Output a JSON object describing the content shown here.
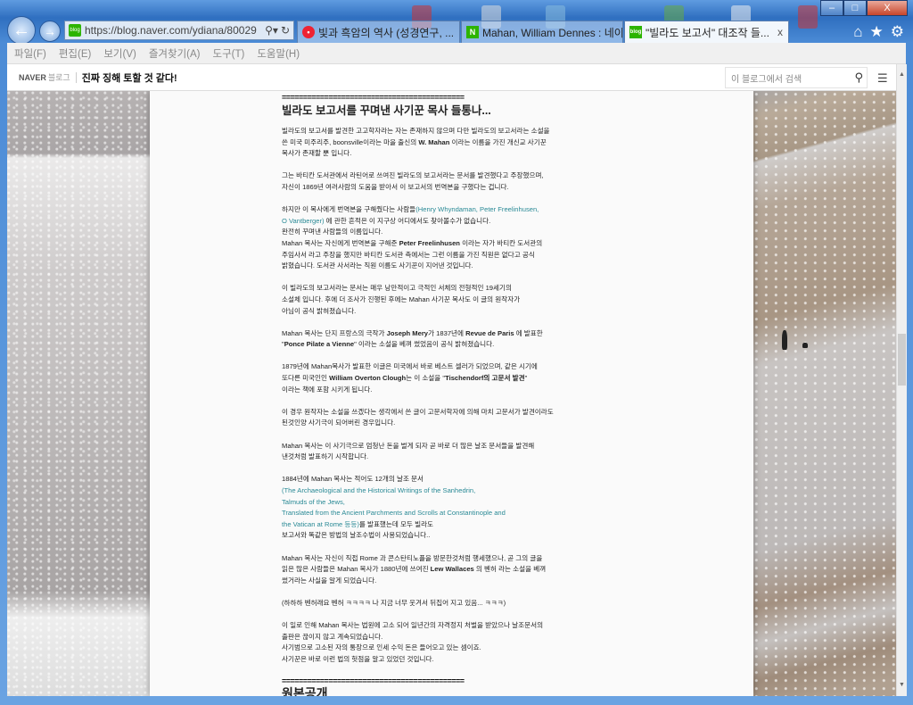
{
  "browser": {
    "address": "https://blog.naver.com/ydiana/80029",
    "tabs": [
      {
        "label": "빛과 흑암의 역사 (성경연구, ...",
        "icon": "red-circle-icon"
      },
      {
        "label": "Mahan, William Dennes : 네이...",
        "icon": "naver-n-icon"
      },
      {
        "label": "\"빌라도 보고서\" 대조작 들...",
        "icon": "blog-icon"
      }
    ],
    "tab_close": "x",
    "menu": [
      "파일(F)",
      "편집(E)",
      "보기(V)",
      "즐겨찾기(A)",
      "도구(T)",
      "도움말(H)"
    ],
    "window_buttons": {
      "min": "–",
      "max": "□",
      "close": "X"
    }
  },
  "blog": {
    "brand": "NAVER",
    "brand_sub": "블로그",
    "title": "진짜 징해 토할 것 같다!",
    "search_placeholder": "이 블로그에서 검색"
  },
  "article": {
    "divider": "===========================================",
    "title": "빌라도 보고서를 꾸며낸 사기꾼 목사 들통나...",
    "paragraphs": [
      [
        [
          [
            "빌라도의 보고서를 발견한 고고학자라는 자는 존재하지 않으며 다만 빌라도의 보고서라는 소설을",
            ""
          ]
        ],
        [
          [
            "쓴 미국 미주리주, boonsville이라는 마을 출신의 ",
            ""
          ],
          [
            "W. Mahan",
            "b"
          ],
          [
            " 이라는 이름을 가진 개신교 사기꾼",
            ""
          ]
        ],
        [
          [
            "목사가 존재할 뿐 입니다.",
            ""
          ]
        ]
      ],
      [
        [
          [
            "그는 바티칸 도서관에서 라틴어로 쓰여진 빌라도의 보고서라는 문서를 발견했다고 주장했으며,",
            ""
          ]
        ],
        [
          [
            "자신이 1869년 여러사람의 도움을 받아서 이 보고서의 번역본을 구했다는 겁니다.",
            ""
          ]
        ]
      ],
      [
        [
          [
            "하지만 이 목사에게 번역본을 구해줬다는 사람들",
            ""
          ],
          [
            "(Henry Whyndaman, Peter Freelinhusen,",
            "lnk"
          ]
        ],
        [
          [
            "O Vantberger)",
            "lnk"
          ],
          [
            " 에 관한 흔적은 이 지구상 어디에서도 찾아볼수가 없습니다.",
            ""
          ]
        ],
        [
          [
            "완전히 꾸며낸 사람들의 이름입니다.",
            ""
          ]
        ],
        [
          [
            "Mahan 목사는 자신에게 번역본을 구해준 ",
            ""
          ],
          [
            "Peter Freelinhusen",
            "b"
          ],
          [
            " 이라는 자가 바티칸 도서관의",
            ""
          ]
        ],
        [
          [
            "주임사서 라고 주장을 했지만 바티칸 도서관 측에서는 그런 이름을 가진 직원은 없다고 공식",
            ""
          ]
        ],
        [
          [
            "밝혔습니다. 도서관 사서라는 직원 이름도 사기꾼이 지어낸 것입니다.",
            ""
          ]
        ]
      ],
      [
        [
          [
            "이 빌라도의 보고서라는 문서는 매우 낭만적이고 극적인 서체의 전형적인 19세기의",
            ""
          ]
        ],
        [
          [
            "소설체 입니다. 후에 더 조사가 진행된 후에는 Mahan 사기꾼 목사도 이 글의 원작자가",
            ""
          ]
        ],
        [
          [
            "아님이 공식 밝혀졌습니다.",
            ""
          ]
        ]
      ],
      [
        [
          [
            "Mahan 목사는 단지 프랑스의 극작가 ",
            ""
          ],
          [
            "Joseph Mery",
            "b"
          ],
          [
            "가 1837년에 ",
            ""
          ],
          [
            "Revue de Paris",
            "b"
          ],
          [
            " 에 발표한",
            ""
          ]
        ],
        [
          [
            "\"",
            ""
          ],
          [
            "Ponce Pilate a Vienne",
            "b"
          ],
          [
            "\" 이라는 소설을 베껴 썼었음이 공식 밝혀졌습니다.",
            ""
          ]
        ]
      ],
      [
        [
          [
            "1879년에 Mahan목사가 발표한 이글은 미국에서 바로 베스트 셀러가 되었으며, 같은 시기에",
            ""
          ]
        ],
        [
          [
            "또다른 미국인인 ",
            ""
          ],
          [
            "William Overton Clough",
            "b"
          ],
          [
            "는 이 소설을 \"",
            ""
          ],
          [
            "Tischendorf의 고문서 발견",
            "b"
          ],
          [
            "\"",
            ""
          ]
        ],
        [
          [
            "이라는 책에 포함 시키게 됩니다.",
            ""
          ]
        ]
      ],
      [
        [
          [
            "이 경우 원작자는 소설을 쓰겠다는 생각에서 쓴 글이 고문서학자에 의해 마치 고문서가 발견이라도",
            ""
          ]
        ],
        [
          [
            "된것인양 사기극이 되어버린 경우입니다.",
            ""
          ]
        ]
      ],
      [
        [
          [
            "Mahan 목사는 이 사기극으로 엄청난 돈을 벌게 되자 곧 바로 더 많은 날조 문서들을 발견해",
            ""
          ]
        ],
        [
          [
            "낸것처럼 발표하기 시작합니다.",
            ""
          ]
        ]
      ],
      [
        [
          [
            "1884년에 Mahan 목사는 적어도 12개의 날조 문서",
            ""
          ]
        ],
        [
          [
            "(The Archaeological and the Historical Writings of the Sanhedrin,",
            "lnk"
          ]
        ],
        [
          [
            "Talmuds of the Jews,",
            "lnk"
          ]
        ],
        [
          [
            "Translated from the Ancient Parchments and Scrolls at Constantinople and",
            "lnk"
          ]
        ],
        [
          [
            "the Vatican at Rome 등등)",
            "lnk"
          ],
          [
            "를 발표했는데 모두 빌라도",
            ""
          ]
        ],
        [
          [
            "보고서와 똑같은 방법의 날조수법이 사용되었습니다..",
            ""
          ]
        ]
      ],
      [
        [
          [
            "Mahan 목사는 자신이 직접 Rome 과 콘스탄티노플을 방문한것처럼 행세했으나, 곧 그의 글을",
            ""
          ]
        ],
        [
          [
            "읽은 많은 사람들은 Mahan 목사가 1880년에 쓰여진 ",
            ""
          ],
          [
            "Lew Wallaces",
            "b"
          ],
          [
            " 의 벤허 라는 소설을 베껴",
            ""
          ]
        ],
        [
          [
            "썼거라는 사실을 알게 되었습니다.",
            ""
          ]
        ]
      ],
      [
        [
          [
            "(하하하 벤허래요 벤허 ㅋㅋㅋㅋ 나 지금 너무 웃겨서 뒤집어 지고 있음... ㅋㅋㅋ)",
            ""
          ]
        ]
      ],
      [
        [
          [
            "이 일로 인해 Mahan 목사는 법원에 고소 되어 일년간의 자격정지 처벌을 받았으나 날조문서의",
            ""
          ]
        ],
        [
          [
            "출판은 끊이지 않고 계속되었습니다.",
            ""
          ]
        ],
        [
          [
            "사기범으로 고소된 자의 통장으로 인세 수익 돈은 들어오고 있는 셈이죠.",
            ""
          ]
        ],
        [
          [
            "사기꾼은 바로 이런 법의 헛점을 알고 있었던 것입니다.",
            ""
          ]
        ]
      ]
    ],
    "section_title": "원본공개"
  },
  "colors": {
    "link": "#2a8a96",
    "frame": "#3a7dc9"
  }
}
